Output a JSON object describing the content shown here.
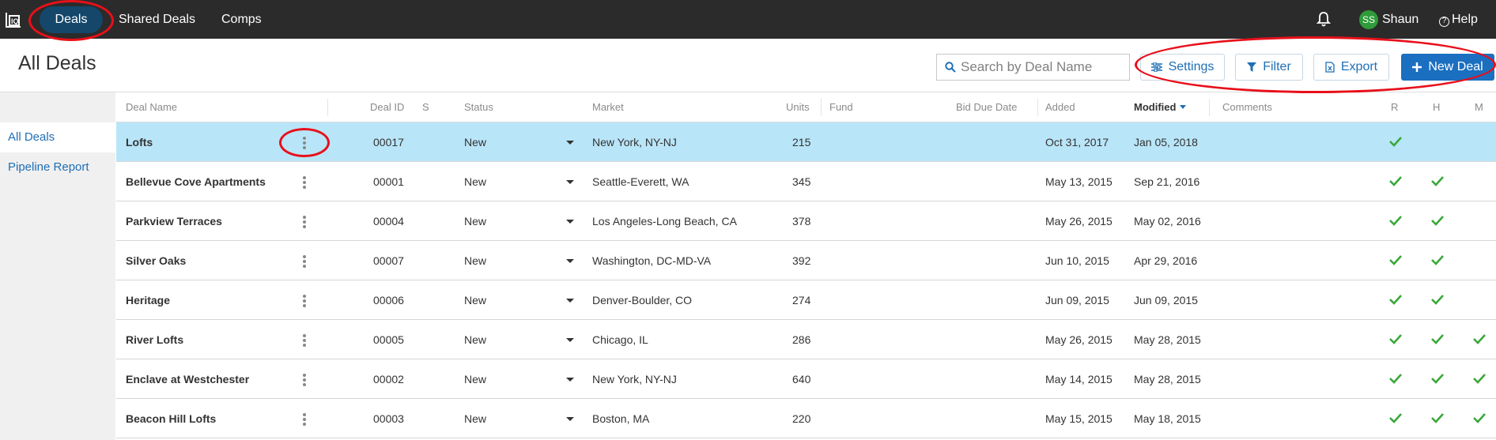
{
  "nav": {
    "logo_icon": "app-logo-icon",
    "items": [
      {
        "label": "Deals",
        "active": true
      },
      {
        "label": "Shared Deals",
        "active": false
      },
      {
        "label": "Comps",
        "active": false
      }
    ],
    "bell_icon": "bell-icon",
    "user": {
      "initials": "SS",
      "name": "Shaun",
      "avatar_color": "#2f9b3a"
    },
    "help_label": "Help"
  },
  "header": {
    "title": "All Deals",
    "search_placeholder": "Search by Deal Name",
    "buttons": {
      "settings": "Settings",
      "filter": "Filter",
      "export": "Export",
      "new_deal": "New Deal"
    }
  },
  "sidebar": {
    "items": [
      {
        "label": "All Deals",
        "active": true
      },
      {
        "label": "Pipeline Report",
        "active": false
      }
    ]
  },
  "table": {
    "columns": {
      "deal_name": "Deal Name",
      "deal_id": "Deal ID",
      "s": "S",
      "status": "Status",
      "market": "Market",
      "units": "Units",
      "fund": "Fund",
      "bid_due_date": "Bid Due Date",
      "added": "Added",
      "modified": "Modified",
      "comments": "Comments",
      "r": "R",
      "h": "H",
      "m": "M"
    },
    "sorted_column": "modified",
    "sort_direction": "descending",
    "rows": [
      {
        "name": "Lofts",
        "id": "00017",
        "status": "New",
        "market": "New York, NY-NJ",
        "units": "215",
        "added": "Oct 31, 2017",
        "modified": "Jan 05, 2018",
        "r": true,
        "h": false,
        "m": false,
        "selected": true
      },
      {
        "name": "Bellevue Cove Apartments",
        "id": "00001",
        "status": "New",
        "market": "Seattle-Everett, WA",
        "units": "345",
        "added": "May 13, 2015",
        "modified": "Sep 21, 2016",
        "r": true,
        "h": true,
        "m": false,
        "selected": false
      },
      {
        "name": "Parkview Terraces",
        "id": "00004",
        "status": "New",
        "market": "Los Angeles-Long Beach, CA",
        "units": "378",
        "added": "May 26, 2015",
        "modified": "May 02, 2016",
        "r": true,
        "h": true,
        "m": false,
        "selected": false
      },
      {
        "name": "Silver Oaks",
        "id": "00007",
        "status": "New",
        "market": "Washington, DC-MD-VA",
        "units": "392",
        "added": "Jun 10, 2015",
        "modified": "Apr 29, 2016",
        "r": true,
        "h": true,
        "m": false,
        "selected": false
      },
      {
        "name": "Heritage",
        "id": "00006",
        "status": "New",
        "market": "Denver-Boulder, CO",
        "units": "274",
        "added": "Jun 09, 2015",
        "modified": "Jun 09, 2015",
        "r": true,
        "h": true,
        "m": false,
        "selected": false
      },
      {
        "name": "River Lofts",
        "id": "00005",
        "status": "New",
        "market": "Chicago, IL",
        "units": "286",
        "added": "May 26, 2015",
        "modified": "May 28, 2015",
        "r": true,
        "h": true,
        "m": true,
        "selected": false
      },
      {
        "name": "Enclave at Westchester",
        "id": "00002",
        "status": "New",
        "market": "New York, NY-NJ",
        "units": "640",
        "added": "May 14, 2015",
        "modified": "May 28, 2015",
        "r": true,
        "h": true,
        "m": true,
        "selected": false
      },
      {
        "name": "Beacon Hill Lofts",
        "id": "00003",
        "status": "New",
        "market": "Boston, MA",
        "units": "220",
        "added": "May 15, 2015",
        "modified": "May 18, 2015",
        "r": true,
        "h": true,
        "m": true,
        "selected": false
      }
    ]
  },
  "colors": {
    "topbar": "#2b2b2b",
    "active_nav": "#14476a",
    "accent": "#1a6fc0",
    "selected_row": "#b9e5f8",
    "check": "#3aa83a",
    "annotation": "#e8101a"
  }
}
